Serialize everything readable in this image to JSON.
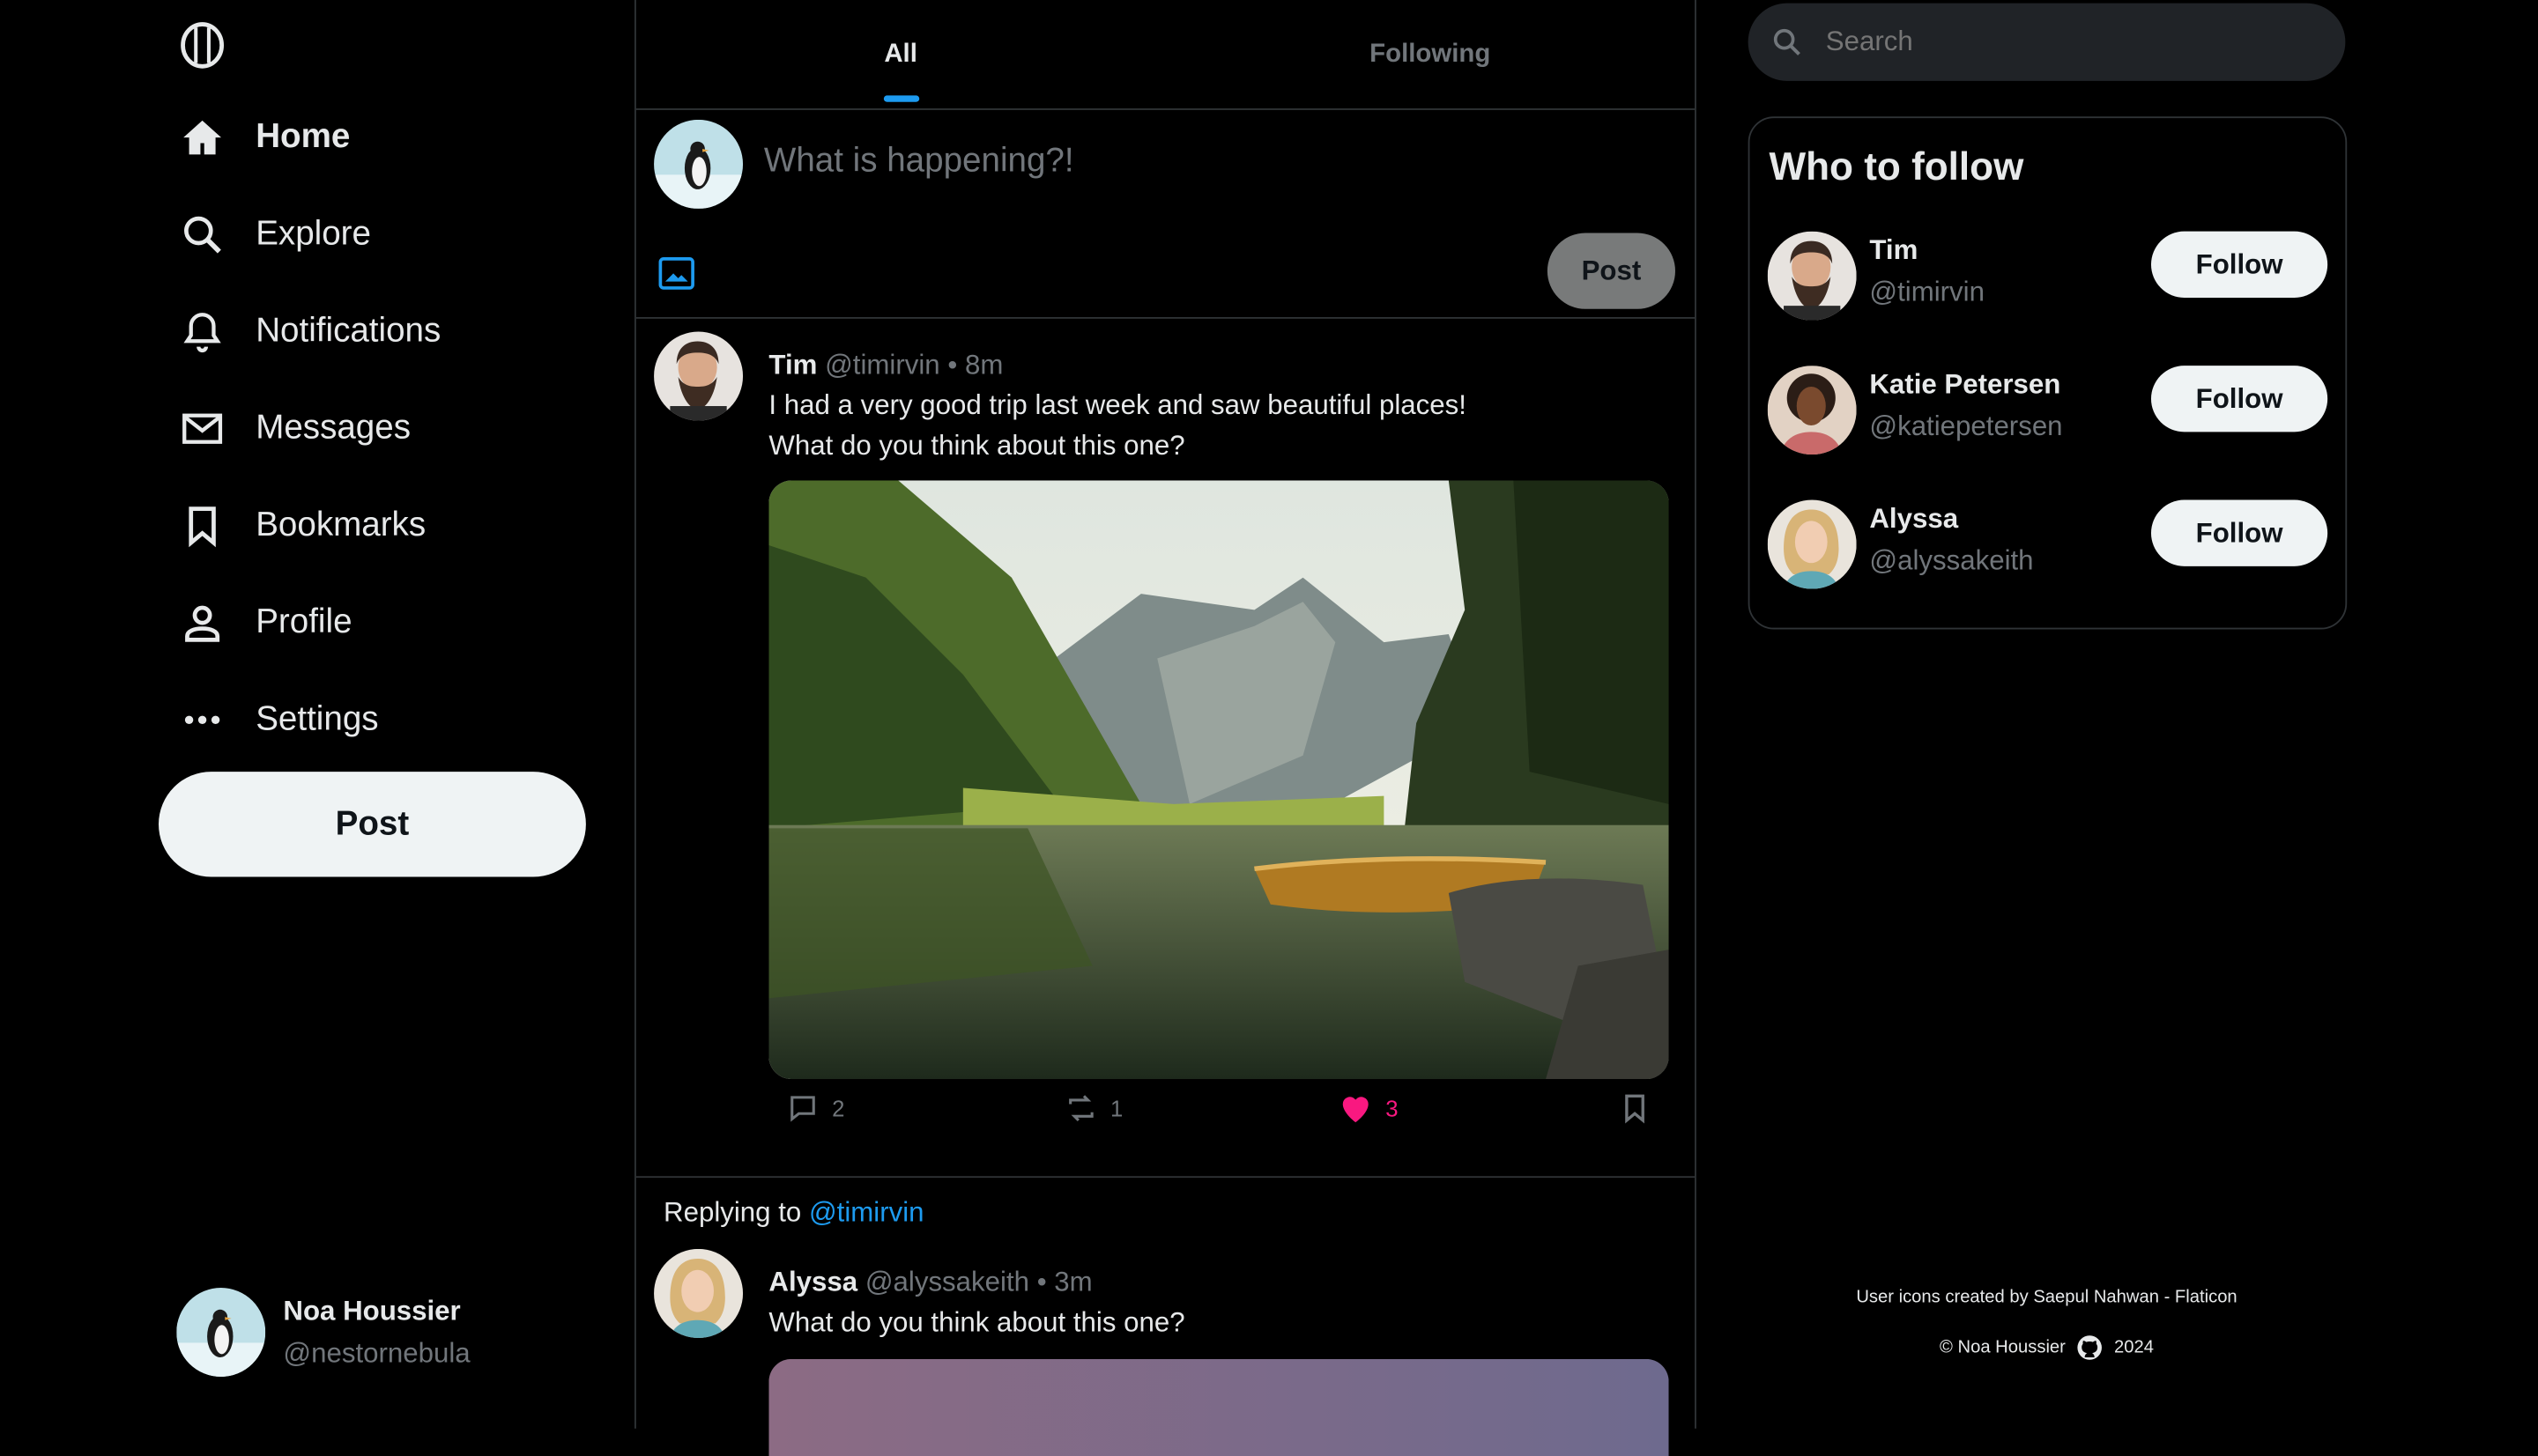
{
  "nav": {
    "items": [
      {
        "label": "Home",
        "icon": "home-icon"
      },
      {
        "label": "Explore",
        "icon": "search-icon"
      },
      {
        "label": "Notifications",
        "icon": "bell-icon"
      },
      {
        "label": "Messages",
        "icon": "mail-icon"
      },
      {
        "label": "Bookmarks",
        "icon": "bookmark-icon"
      },
      {
        "label": "Profile",
        "icon": "person-icon"
      },
      {
        "label": "Settings",
        "icon": "more-icon"
      }
    ],
    "post_label": "Post"
  },
  "me": {
    "name": "Noa Houssier",
    "handle": "@nestornebula"
  },
  "tabs": {
    "all": "All",
    "following": "Following"
  },
  "composer": {
    "placeholder": "What is happening?!",
    "post_label": "Post"
  },
  "tweets": [
    {
      "name": "Tim",
      "handle": "@timirvin",
      "time": "• 8m",
      "text": "I had a very good trip last week and saw beautiful places!\nWhat do you think about this one?",
      "replies": "2",
      "reposts": "1",
      "likes": "3"
    },
    {
      "replying_label": "Replying to",
      "replying_to": "@timirvin",
      "name": "Alyssa",
      "handle": "@alyssakeith",
      "time": "• 3m",
      "text": "What do you think about this one?"
    }
  ],
  "search": {
    "placeholder": "Search"
  },
  "who_to_follow": {
    "title": "Who to follow",
    "users": [
      {
        "name": "Tim",
        "handle": "@timirvin",
        "button": "Follow"
      },
      {
        "name": "Katie Petersen",
        "handle": "@katiepetersen",
        "button": "Follow"
      },
      {
        "name": "Alyssa",
        "handle": "@alyssakeith",
        "button": "Follow"
      }
    ]
  },
  "footer": {
    "credits": "User icons created by Saepul Nahwan - Flaticon",
    "copyright_name": "© Noa Houssier",
    "year": "2024"
  },
  "colors": {
    "accent": "#1d9bf0",
    "like": "#f91880",
    "bg": "#000000"
  }
}
